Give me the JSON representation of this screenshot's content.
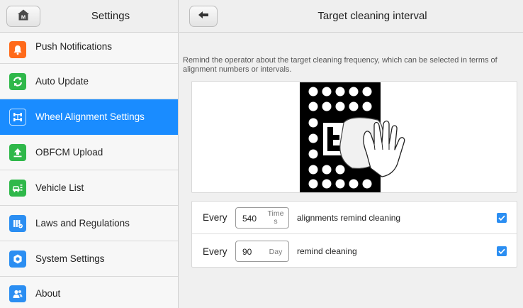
{
  "sidebar": {
    "title": "Settings",
    "home_icon": "home-icon",
    "items": [
      {
        "label": "Push Notifications",
        "icon": "notification-bell-icon",
        "color": "#ff6a1a",
        "active": false
      },
      {
        "label": "Auto Update",
        "icon": "update-arrows-icon",
        "color": "#2fb84a",
        "active": false
      },
      {
        "label": "Wheel Alignment Settings",
        "icon": "alignment-icon",
        "color": "#1a8cff",
        "active": true
      },
      {
        "label": "OBFCM Upload",
        "icon": "upload-icon",
        "color": "#2fb84a",
        "active": false
      },
      {
        "label": "Vehicle List",
        "icon": "vehicle-list-icon",
        "color": "#2fb84a",
        "active": false
      },
      {
        "label": "Laws and Regulations",
        "icon": "laws-regulations-icon",
        "color": "#2b8ef2",
        "active": false
      },
      {
        "label": "System Settings",
        "icon": "gear-icon",
        "color": "#2b8ef2",
        "active": false
      },
      {
        "label": "About",
        "icon": "about-people-icon",
        "color": "#2b8ef2",
        "active": false
      }
    ]
  },
  "main": {
    "title": "Target cleaning interval",
    "back_icon": "back-arrow-icon",
    "description": "Remind the operator about the target cleaning frequency, which can be selected in terms of alignment numbers or intervals.",
    "illustration": "target-cleaning-illustration",
    "options": [
      {
        "prefix": "Every",
        "value": "540",
        "unit": "Times",
        "text": "alignments remind cleaning",
        "checked": true
      },
      {
        "prefix": "Every",
        "value": "90",
        "unit": "Day",
        "text": "remind cleaning",
        "checked": true
      }
    ]
  },
  "colors": {
    "accent": "#1a8cff",
    "checkbox": "#2b8ef2"
  }
}
